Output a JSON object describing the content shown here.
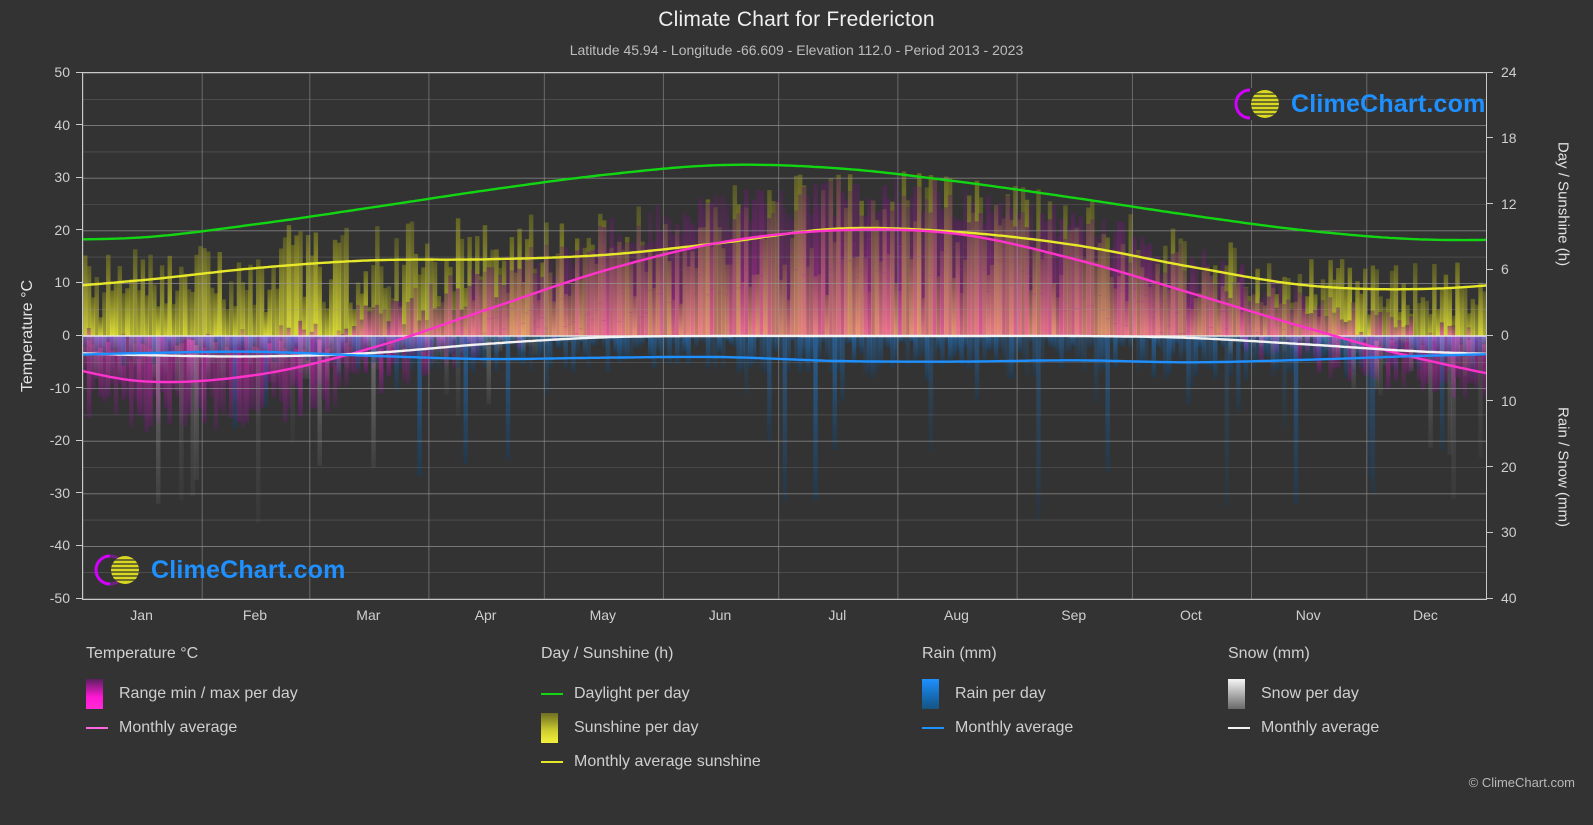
{
  "header": {
    "title": "Climate Chart for Fredericton",
    "subtitle": "Latitude 45.94 - Longitude -66.609 - Elevation 112.0 - Period 2013 - 2023"
  },
  "axes": {
    "left_label": "Temperature °C",
    "right_top_label": "Day / Sunshine (h)",
    "right_bottom_label": "Rain / Snow (mm)",
    "left_ticks": [
      "50",
      "40",
      "30",
      "20",
      "10",
      "0",
      "-10",
      "-20",
      "-30",
      "-40",
      "-50"
    ],
    "right_top_ticks": [
      "24",
      "18",
      "12",
      "6",
      "0"
    ],
    "right_bottom_ticks": [
      "0",
      "10",
      "20",
      "30",
      "40"
    ],
    "x_ticks": [
      "Jan",
      "Feb",
      "Mar",
      "Apr",
      "May",
      "Jun",
      "Jul",
      "Aug",
      "Sep",
      "Oct",
      "Nov",
      "Dec"
    ]
  },
  "legend": {
    "temperature": {
      "title": "Temperature °C",
      "items": [
        {
          "label": "Range min / max per day",
          "swatch": "gradient-magenta"
        },
        {
          "label": "Monthly average",
          "swatch": "line-magenta"
        }
      ]
    },
    "daysun": {
      "title": "Day / Sunshine (h)",
      "items": [
        {
          "label": "Daylight per day",
          "swatch": "line-green"
        },
        {
          "label": "Sunshine per day",
          "swatch": "gradient-yellow"
        },
        {
          "label": "Monthly average sunshine",
          "swatch": "line-yellow"
        }
      ]
    },
    "rain": {
      "title": "Rain (mm)",
      "items": [
        {
          "label": "Rain per day",
          "swatch": "gradient-blue"
        },
        {
          "label": "Monthly average",
          "swatch": "line-blue"
        }
      ]
    },
    "snow": {
      "title": "Snow (mm)",
      "items": [
        {
          "label": "Snow per day",
          "swatch": "gradient-white"
        },
        {
          "label": "Monthly average",
          "swatch": "line-white"
        }
      ]
    }
  },
  "branding": {
    "logo_text": "ClimeChart.com",
    "copyright": "© ClimeChart.com"
  },
  "colors": {
    "background": "#333333",
    "grid": "#9a9a9a",
    "daylight_green": "#13d613",
    "sunshine_yellow": "#e8e82b",
    "temp_magenta": "#ff33cc",
    "rain_blue": "#1e90ff",
    "snow_white": "#f2f2f2",
    "text": "#d0d0d0"
  },
  "chart_data": {
    "type": "line",
    "title": "Climate Chart for Fredericton",
    "subtitle": "Latitude 45.94 - Longitude -66.609 - Elevation 112.0 - Period 2013 - 2023",
    "xlabel": "",
    "ylabel": "Temperature °C",
    "y2label_top": "Day / Sunshine (h)",
    "y2label_bottom": "Rain / Snow (mm)",
    "ylim": [
      -50,
      50
    ],
    "y2lim_top": [
      0,
      24
    ],
    "y2lim_bottom": [
      0,
      40
    ],
    "grid": true,
    "legend_position": "below",
    "categories": [
      "Jan",
      "Feb",
      "Mar",
      "Apr",
      "May",
      "Jun",
      "Jul",
      "Aug",
      "Sep",
      "Oct",
      "Nov",
      "Dec"
    ],
    "series": [
      {
        "name": "Daylight per day",
        "unit": "h",
        "color": "#13d613",
        "values": [
          9.0,
          10.2,
          11.7,
          13.3,
          14.7,
          15.6,
          15.3,
          14.1,
          12.6,
          11.0,
          9.6,
          8.8
        ]
      },
      {
        "name": "Monthly average sunshine",
        "unit": "h",
        "color": "#e8e82b",
        "values": [
          5.1,
          6.2,
          6.9,
          7.0,
          7.4,
          8.5,
          9.8,
          9.5,
          8.3,
          6.3,
          4.6,
          4.3
        ]
      },
      {
        "name": "Temperature monthly average",
        "unit": "°C",
        "color": "#ff33cc",
        "values": [
          -8.6,
          -7.4,
          -2.4,
          5.0,
          12.4,
          17.8,
          20.1,
          19.4,
          14.6,
          8.1,
          1.4,
          -4.6
        ]
      },
      {
        "name": "Rain monthly average",
        "unit": "mm",
        "color": "#1e90ff",
        "values": [
          2.6,
          2.4,
          3.0,
          3.5,
          3.3,
          3.2,
          3.8,
          3.9,
          3.7,
          4.0,
          3.6,
          3.0
        ]
      },
      {
        "name": "Snow monthly average",
        "unit": "mm",
        "color": "#f2f2f2",
        "values": [
          2.9,
          3.1,
          2.6,
          1.2,
          0.2,
          0.0,
          0.0,
          0.0,
          0.0,
          0.3,
          1.3,
          2.4
        ]
      }
    ],
    "daily_bands": [
      {
        "name": "Range min / max per day",
        "unit": "°C",
        "color": "#ff33cc",
        "max": [
          -3.2,
          -2.0,
          3.0,
          10.6,
          18.6,
          23.8,
          26.2,
          25.4,
          20.6,
          13.4,
          5.6,
          -0.4
        ],
        "min": [
          -14.0,
          -13.0,
          -7.8,
          -0.6,
          6.2,
          11.8,
          14.2,
          13.6,
          8.8,
          2.8,
          -2.8,
          -9.0
        ]
      },
      {
        "name": "Sunshine per day",
        "unit": "h",
        "color": "#e8e82b",
        "values": [
          5.1,
          6.2,
          6.9,
          7.0,
          7.4,
          8.5,
          9.8,
          9.5,
          8.3,
          6.3,
          4.6,
          4.3
        ]
      },
      {
        "name": "Rain per day",
        "unit": "mm",
        "color": "#1e90ff",
        "values": [
          2.6,
          2.4,
          3.0,
          3.5,
          3.3,
          3.2,
          3.8,
          3.9,
          3.7,
          4.0,
          3.6,
          3.0
        ]
      },
      {
        "name": "Snow per day",
        "unit": "mm",
        "color": "#f2f2f2",
        "values": [
          2.9,
          3.1,
          2.6,
          1.2,
          0.2,
          0.0,
          0.0,
          0.0,
          0.0,
          0.3,
          1.3,
          2.4
        ]
      }
    ]
  }
}
